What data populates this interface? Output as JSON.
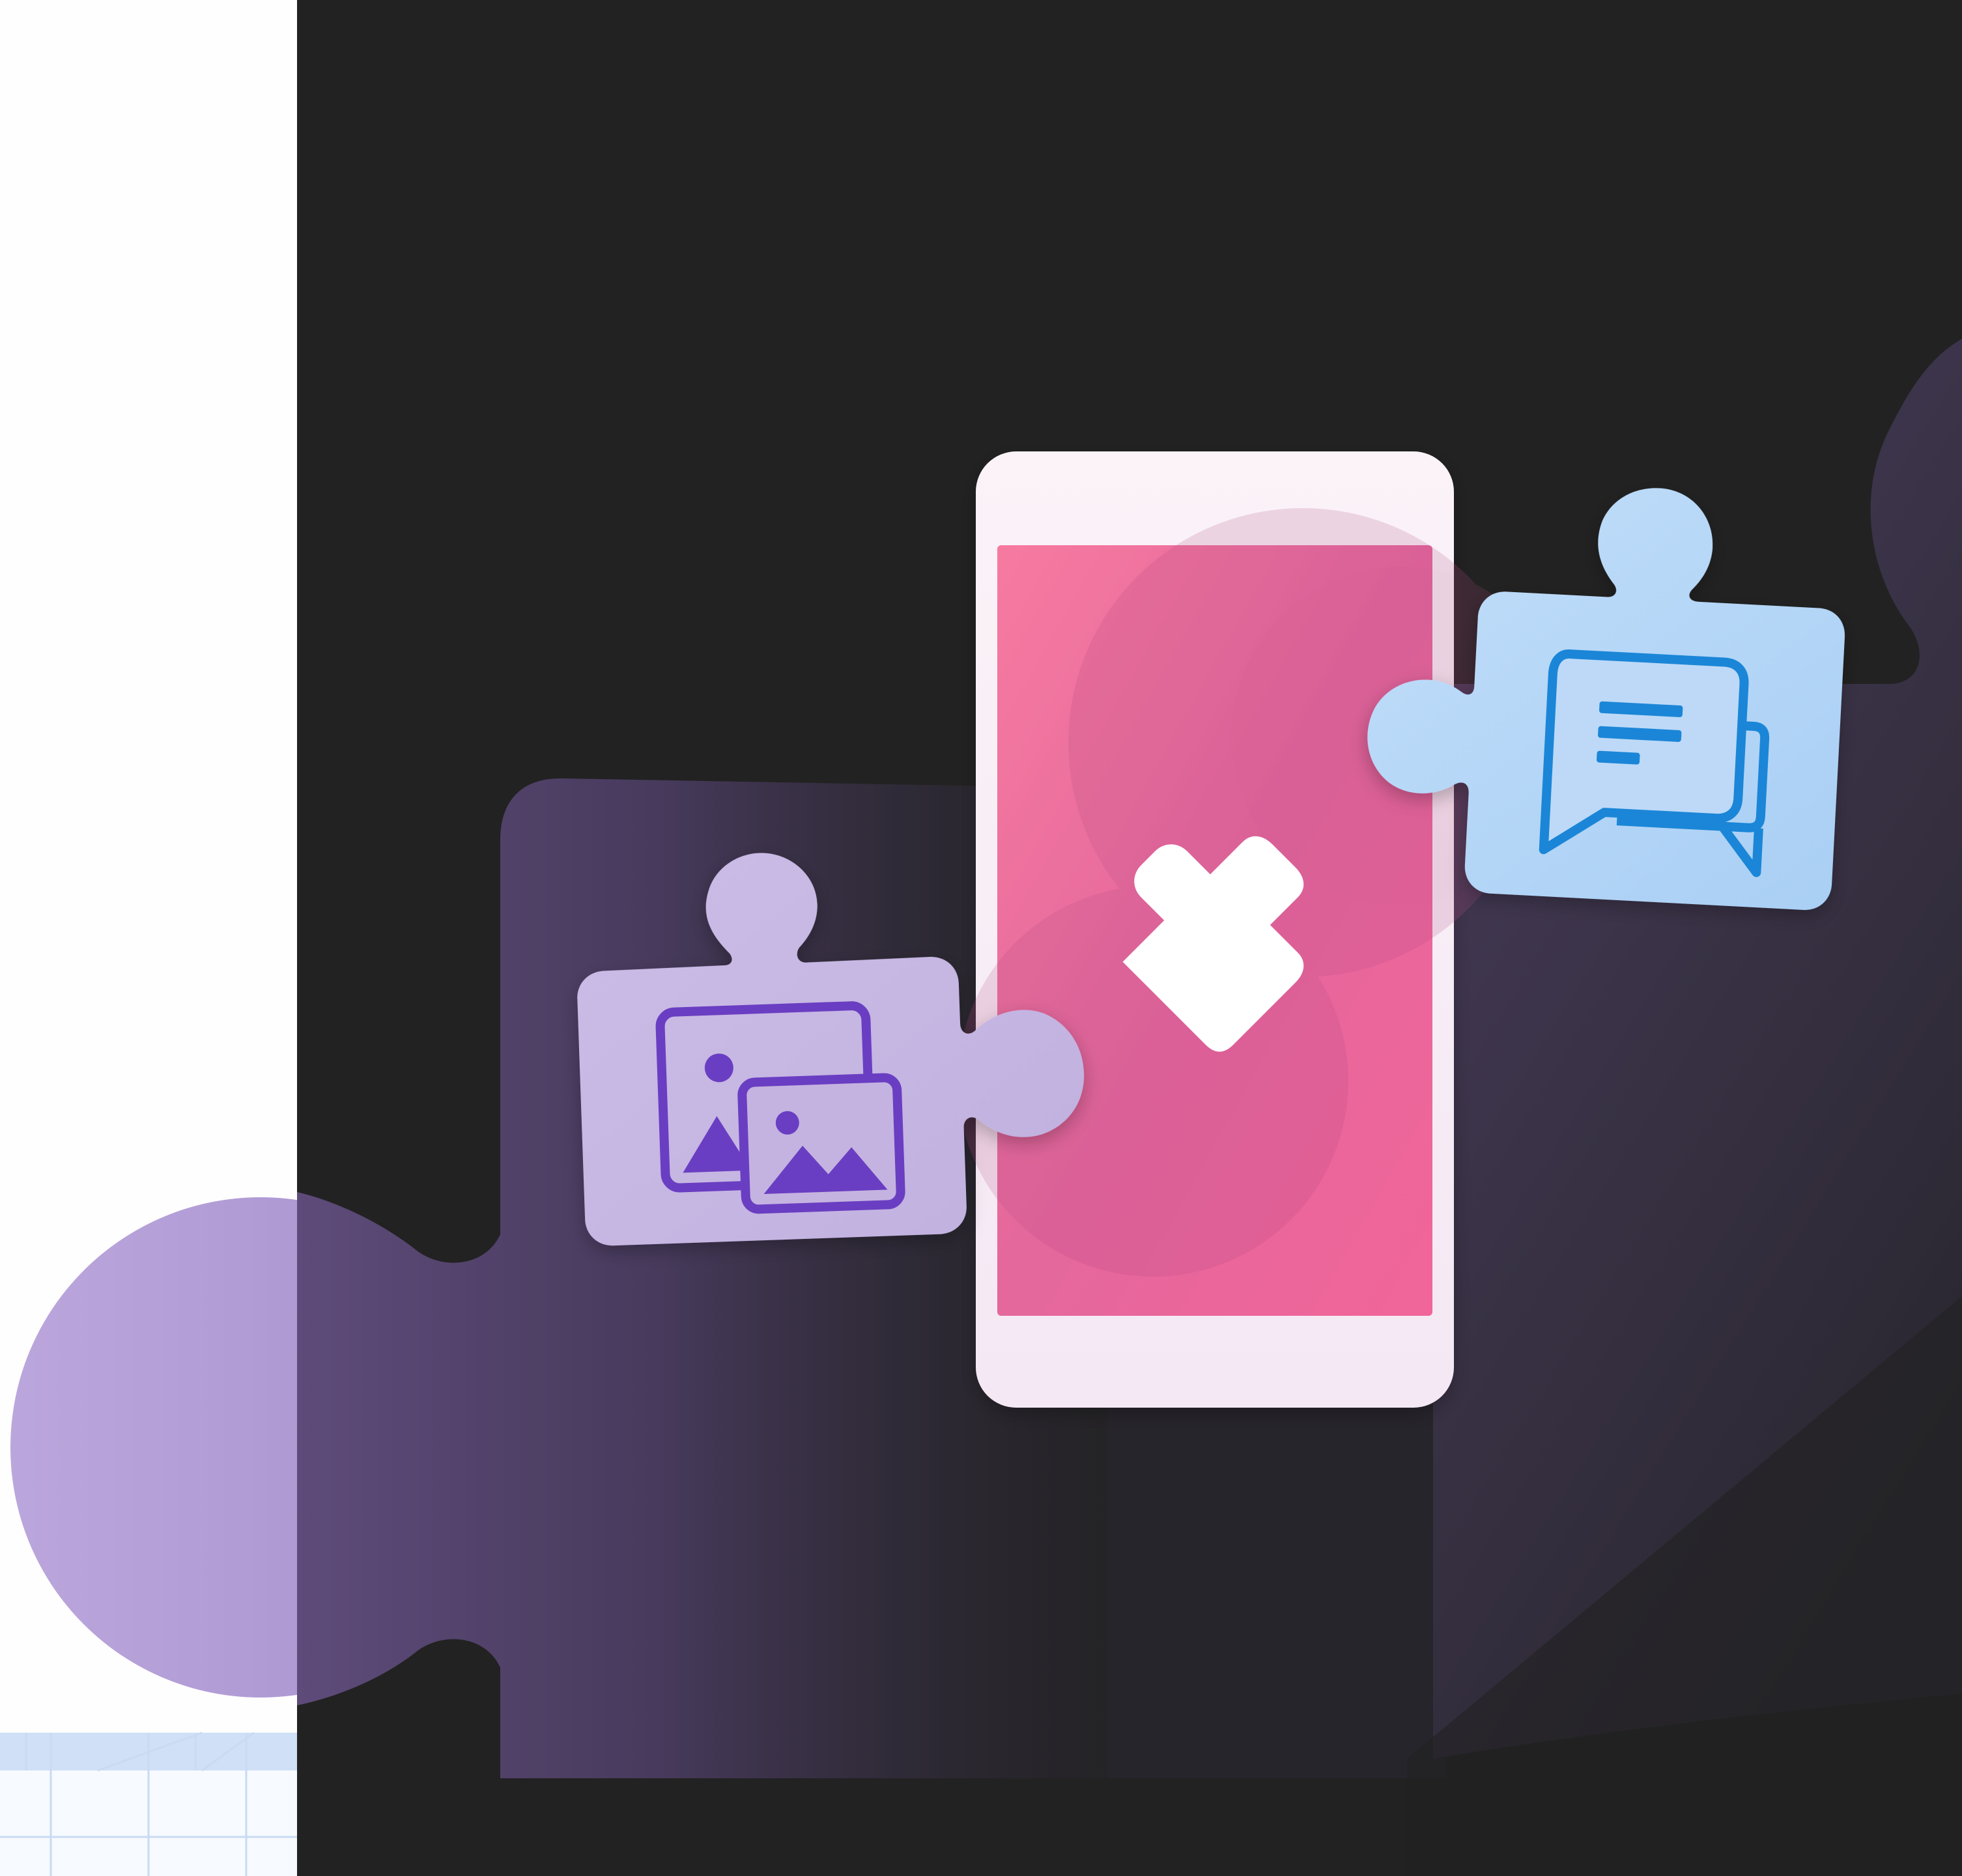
{
  "scene": {
    "background_left": "#fefefe",
    "background_dark": "#222222",
    "accent_pink": "#ee6b9b",
    "accent_purple": "#c4b3e0",
    "accent_blue": "#b8d8f6",
    "icon_purple": "#6a3ec2",
    "icon_blue": "#1b86d7",
    "grid_blue": "#cfe0f7"
  },
  "elements": {
    "phone": {
      "icon": "puzzle-piece-icon"
    },
    "left_piece": {
      "icon": "image-gallery-icon"
    },
    "right_piece": {
      "icon": "chat-bubbles-icon"
    }
  }
}
